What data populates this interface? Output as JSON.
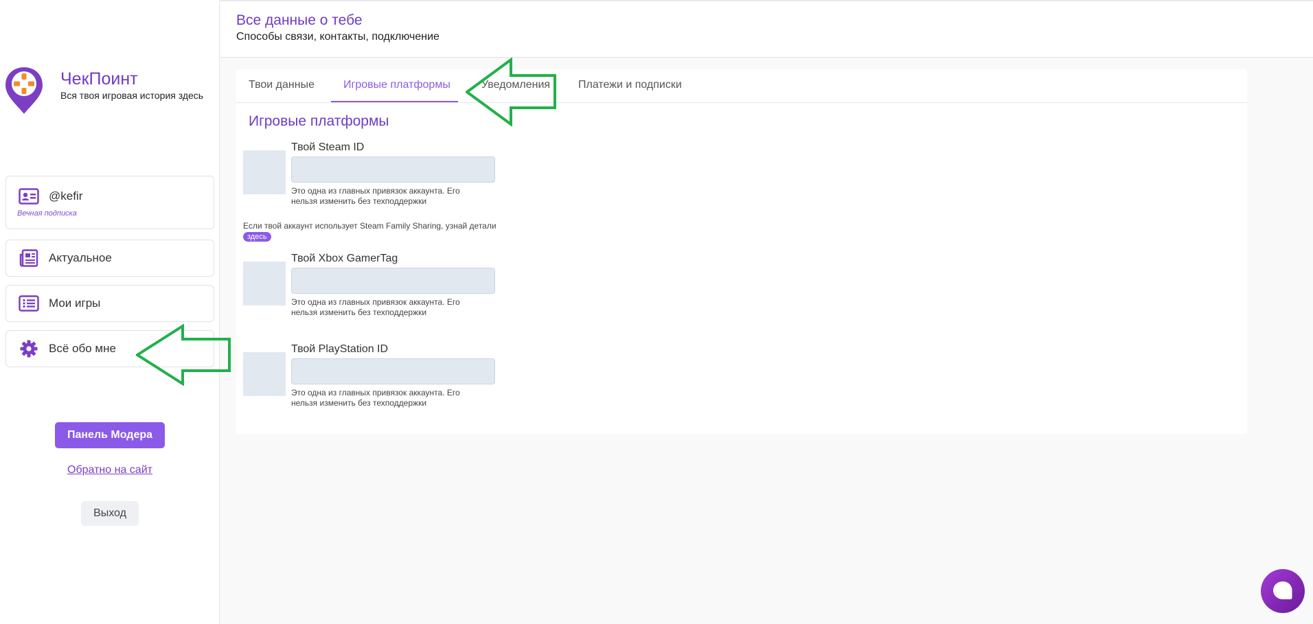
{
  "brand": {
    "name": "ЧекПоинт",
    "tagline": "Вся твоя игровая история здесь"
  },
  "sidebar": {
    "profile": {
      "username": "@kefir",
      "subscription": "Вечная подписка"
    },
    "items": [
      {
        "label": "Актуальное",
        "icon": "newspaper-icon"
      },
      {
        "label": "Мои игры",
        "icon": "list-icon"
      },
      {
        "label": "Всё обо мне",
        "icon": "gear-icon"
      }
    ],
    "moderator_button": "Панель Модера",
    "back_link": "Обратно на сайт",
    "logout_button": "Выход"
  },
  "header": {
    "title": "Все данные о тебе",
    "subtitle": "Способы связи, контакты, подключение"
  },
  "tabs": [
    {
      "label": "Твои данные",
      "active": false
    },
    {
      "label": "Игровые платформы",
      "active": true
    },
    {
      "label": "Уведомления",
      "active": false
    },
    {
      "label": "Платежи и подписки",
      "active": false
    }
  ],
  "main": {
    "section_title": "Игровые платформы",
    "platforms": [
      {
        "label": "Твой Steam ID",
        "value": "",
        "hint": "Это одна из главных привязок аккаунта. Его нельзя изменить без техподдержки"
      },
      {
        "label": "Твой Xbox GamerTag",
        "value": "",
        "hint": "Это одна из главных привязок аккаунта. Его нельзя изменить без техподдержки"
      },
      {
        "label": "Твой PlayStation ID",
        "value": "",
        "hint": "Это одна из главных привязок аккаунта. Его нельзя изменить без техподдержки"
      }
    ],
    "family_sharing_note": "Если твой аккаунт использует Steam Family Sharing, узнай детали",
    "family_sharing_link": "здесь"
  },
  "colors": {
    "accent": "#8b5ae8",
    "title": "#6f3cc2",
    "arrow": "#22b04b",
    "chat_bubble": "#8e2bc2",
    "logo_orange": "#f28c28"
  }
}
